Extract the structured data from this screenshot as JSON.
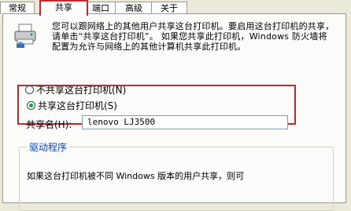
{
  "tabs": [
    {
      "label": "常规"
    },
    {
      "label": "共享"
    },
    {
      "label": "端口"
    },
    {
      "label": "高级"
    },
    {
      "label": "关于"
    }
  ],
  "description": "您可以跟网络上的其他用户共享这台打印机。要启用这台打印机的共享，请单击“共享这台打印机”。 如果您共享此打印机，Windows 防火墙将配置为允许与网络上的其他计算机共享此打印机。",
  "options": {
    "no_share": "不共享这台打印机(N)",
    "share": "共享这台打印机(S)"
  },
  "share_name": {
    "label": "共享名(H):",
    "value": "lenovo LJ3500"
  },
  "driver": {
    "title": "驱动程序",
    "text": "如果这台打印机被不同 Windows 版本的用户共享，则可"
  },
  "icons": {
    "printer": "printer-icon"
  },
  "colors": {
    "highlight": "#c1282d",
    "group_title": "#0046d5"
  }
}
